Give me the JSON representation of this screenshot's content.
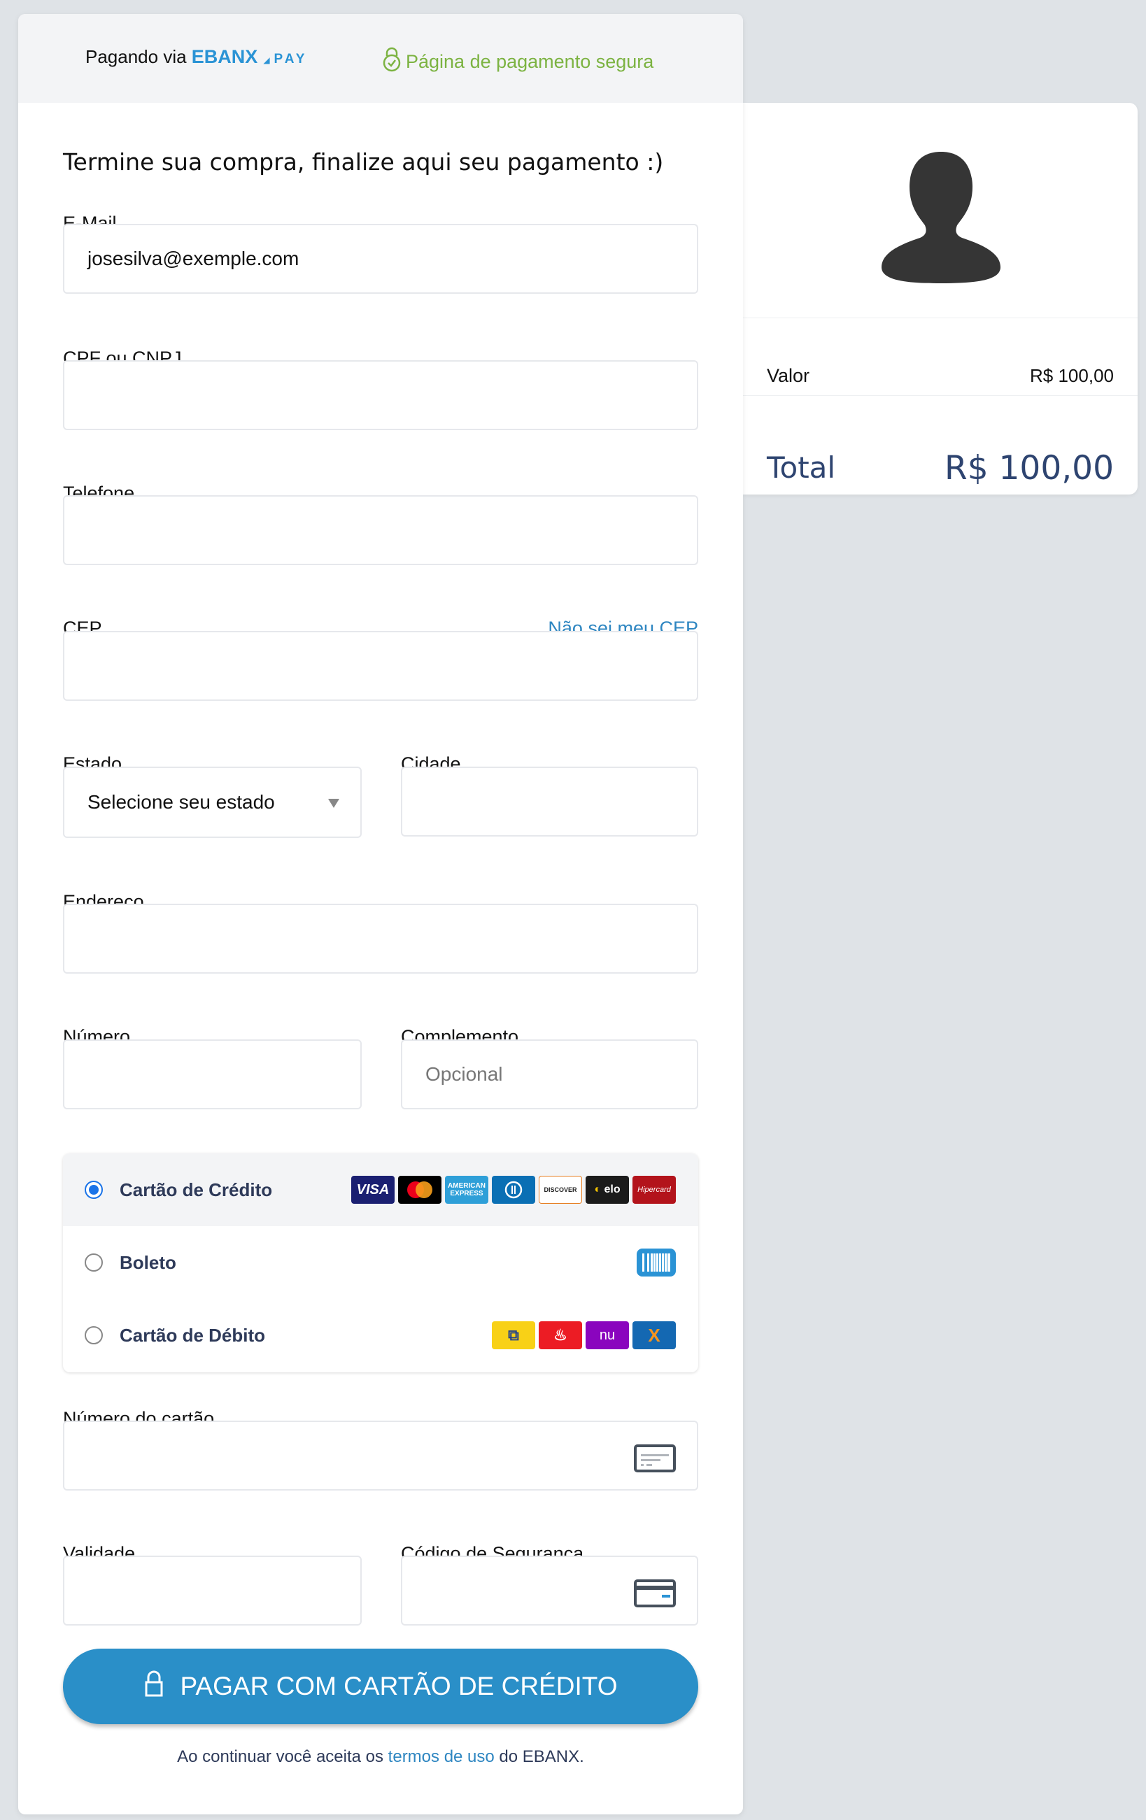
{
  "header": {
    "paying_via": "Pagando via",
    "brand": "EBANX",
    "brand_suffix": "PAY",
    "secure_label": "Página de pagamento segura"
  },
  "form": {
    "title": "Termine sua compra, finalize aqui seu pagamento :)",
    "email": {
      "label": "E-Mail",
      "value": "josesilva@exemple.com"
    },
    "cpf": {
      "label": "CPF ou CNPJ",
      "value": ""
    },
    "phone": {
      "label": "Telefone",
      "value": ""
    },
    "cep": {
      "label": "CEP",
      "value": "",
      "help_link": "Não sei meu CEP"
    },
    "state": {
      "label": "Estado",
      "selected": "Selecione seu estado"
    },
    "city": {
      "label": "Cidade",
      "value": ""
    },
    "address": {
      "label": "Endereço",
      "value": ""
    },
    "number": {
      "label": "Número",
      "value": ""
    },
    "complement": {
      "label": "Complemento",
      "placeholder": "Opcional"
    },
    "card_number": {
      "label": "Número do cartão",
      "value": ""
    },
    "expiry": {
      "label": "Validade",
      "value": ""
    },
    "cvv": {
      "label": "Código de Segurança",
      "value": ""
    }
  },
  "payment_methods": [
    {
      "label": "Cartão de Crédito",
      "selected": true,
      "logos": [
        "VISA",
        "Mastercard",
        "American Express",
        "Diners",
        "Discover",
        "elo",
        "Hipercard"
      ]
    },
    {
      "label": "Boleto",
      "selected": false,
      "logos": [
        "boleto-barcode"
      ]
    },
    {
      "label": "Cartão de Débito",
      "selected": false,
      "logos": [
        "Banco do Brasil",
        "Santander",
        "Nubank",
        "Caixa"
      ]
    }
  ],
  "submit": {
    "label": "PAGAR COM CARTÃO DE CRÉDITO",
    "color": "#2a8fc8"
  },
  "terms": {
    "prefix": "Ao continuar você aceita os",
    "link": "termos de uso",
    "suffix": "do EBANX."
  },
  "summary": {
    "value_label": "Valor",
    "value": "R$ 100,00",
    "total_label": "Total",
    "total": "R$ 100,00"
  },
  "colors": {
    "brand": "#2a93d5",
    "secure": "#7cb342",
    "total_text": "#2e4470",
    "link": "#2e86c1"
  }
}
